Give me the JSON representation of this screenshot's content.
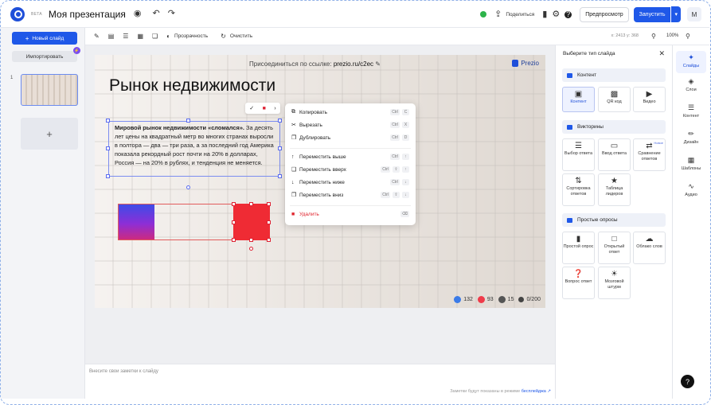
{
  "header": {
    "beta": "BETA",
    "title": "Моя презентация",
    "share": "Поделиться",
    "preview": "Предпросмотр",
    "run": "Запустить",
    "avatar": "М"
  },
  "sidebar": {
    "new_slide": "Новый слайд",
    "import": "Импортировать",
    "slide_number": "1",
    "add": "+"
  },
  "toolbar": {
    "transparency": "Прозрачность",
    "clear": "Очистить",
    "coords": "x: 2413 y: 368",
    "zoom": "100%"
  },
  "slide": {
    "join_label": "Присоединиться по ссылке:",
    "join_link": "prezio.ru/c2ec",
    "brand": "Prezio",
    "heading": "Рынок недвижимости",
    "text_bold": "Мировой рынок недвижимости «сломался».",
    "text_rest": " За десять лет цены на квадратный метр во многих странах выросли в полтора — два — три раза, а за последний год Америка показала рекордный рост почти на 20% в долларах, Россия — на 20% в рублях, и тенденция не меняется.",
    "stats": {
      "likes": "132",
      "hearts": "93",
      "hands": "15",
      "users": "0/200"
    }
  },
  "context_menu": {
    "items": [
      {
        "label": "Копировать",
        "keys": [
          "Ctrl",
          "C"
        ]
      },
      {
        "label": "Вырезать",
        "keys": [
          "Ctrl",
          "X"
        ]
      },
      {
        "label": "Дублировать",
        "keys": [
          "Ctrl",
          "D"
        ]
      },
      {
        "label": "Переместить выше",
        "keys": [
          "Ctrl",
          "↑"
        ]
      },
      {
        "label": "Переместить вверх",
        "keys": [
          "Ctrl",
          "⇧",
          "↑"
        ]
      },
      {
        "label": "Переместить ниже",
        "keys": [
          "Ctrl",
          "↓"
        ]
      },
      {
        "label": "Переместить вниз",
        "keys": [
          "Ctrl",
          "⇧",
          "↓"
        ]
      },
      {
        "label": "Удалить",
        "keys": [
          "⌫"
        ]
      }
    ]
  },
  "notes": {
    "placeholder": "Внесите свои заметки к слайду",
    "hint": "Заметки будут показаны в режиме",
    "hint_link": "бесплейджа"
  },
  "right_panel": {
    "title": "Выберите тип слайда",
    "sections": {
      "content": "Контент",
      "quizzes": "Викторины",
      "polls": "Простые опросы"
    },
    "content_cards": [
      "Контент",
      "QR код",
      "Видео"
    ],
    "quiz_cards": [
      "Выбор ответа",
      "Ввод ответа",
      "Сравнение ответов",
      "Сортировка ответов",
      "Таблица лидеров"
    ],
    "quiz_new_tag": "Новое",
    "poll_cards": [
      "Простой опрос",
      "Открытый ответ",
      "Облако слов",
      "Вопрос ответ",
      "Мозговой штурм"
    ]
  },
  "far_right": {
    "items": [
      "Слайды",
      "Слои",
      "Контент",
      "Дизайн",
      "Шаблоны",
      "Аудио"
    ]
  },
  "colors": {
    "accent": "#1f58e8",
    "danger": "#ef2b34"
  }
}
